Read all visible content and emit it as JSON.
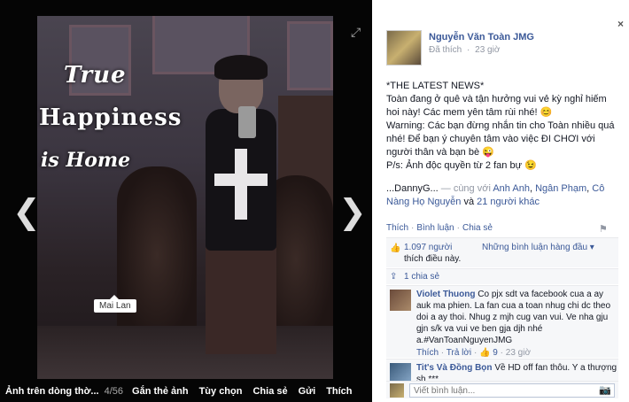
{
  "viewer": {
    "overlay_lines": [
      "True",
      "Happiness",
      "is Home"
    ],
    "tag_label": "Mai Lan",
    "prev_glyph": "❮",
    "next_glyph": "❯",
    "expand_glyph": "⤢",
    "bottom_bar": {
      "album": "Ảnh trên dòng thờ...",
      "count": "4/56",
      "tag": "Gắn thẻ ảnh",
      "options": "Tùy chọn",
      "share": "Chia sẻ",
      "send": "Gửi",
      "like": "Thích"
    }
  },
  "panel": {
    "close_glyph": "×",
    "author": "Nguyễn Văn Toàn JMG",
    "liked_label": "Đã thích",
    "dot": "·",
    "time": "23 giờ",
    "post_lines": [
      "*THE LATEST NEWS*",
      "Toàn đang ở quê và tận hưởng vui vẻ kỳ nghỉ hiếm hoi này! Các mem yên tâm rùi nhé! 😊",
      "Warning: Các bạn đừng nhắn tin cho Toàn nhiều quá nhé! Để bạn ý chuyên tâm vào việc ĐI CHƠI với người thân và bạn bè 😜",
      "P/s: Ảnh độc quyền từ 2 fan bự 😉"
    ],
    "with": {
      "prefix": "...DannyG...",
      "dash": " — cùng với ",
      "p1": "Anh Anh",
      "sep1": ", ",
      "p2": "Ngân Phạm",
      "sep2": ", ",
      "p3": "Cô Nàng Họ Nguyễn",
      "and": " và ",
      "others": "21 người khác"
    },
    "actions": {
      "like": "Thích",
      "comment": "Bình luận",
      "share": "Chia sẻ"
    },
    "likes": {
      "count": "1.097 người",
      "text": "thích điều này.",
      "sort": "Những bình luận hàng đầu ▾"
    },
    "shares": "1 chia sẻ",
    "comments": [
      {
        "name": "Violet Thuong",
        "text": "Co pjx sdt va facebook cua a ay auk ma phien. La fan cua a toan nhug chi dc theo doi a ay thoi. Nhug z mjh cug van vui. Ve nha gju gjn s/k va vui ve ben gja djh nhé a.#VanToanNguyenJMG",
        "like": "Thích",
        "reply": "Trả lời",
        "likes": "👍 9",
        "time": "23 giờ"
      },
      {
        "name": "Tit's Và Đồng Bọn",
        "text": "Về HD off fan thôu. Y a thượng sh ***"
      }
    ],
    "composer_placeholder": "Viết bình luận...",
    "camera_glyph": "📷",
    "flag_glyph": "⚑"
  }
}
